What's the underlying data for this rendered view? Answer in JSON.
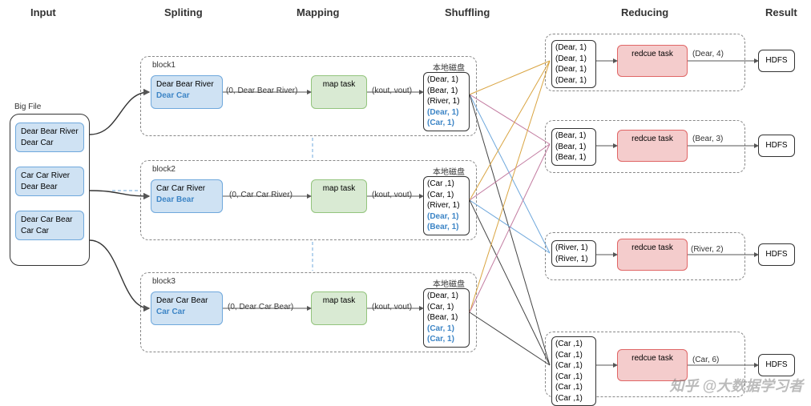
{
  "stages": {
    "input": "Input",
    "splitting": "Spliting",
    "mapping": "Mapping",
    "shuffling": "Shuffling",
    "reducing": "Reducing",
    "result": "Result"
  },
  "input": {
    "title": "Big File",
    "lines": [
      "Dear Bear River\nDear Car",
      "Car Car River\nDear Bear",
      "Dear Car Bear\nCar Car"
    ]
  },
  "blocks": [
    {
      "name": "block1",
      "split_text": "Dear Bear River",
      "split_extra": "Dear Car",
      "map_input": "(0, Dear Bear River)",
      "map_task": "map task",
      "map_output_label": "(kout, vout)",
      "disk_label": "本地磁盘",
      "disk_lines": [
        "(Dear, 1)",
        "(Bear, 1)",
        "(River, 1)"
      ],
      "disk_extra": [
        "(Dear, 1)",
        "(Car, 1)"
      ]
    },
    {
      "name": "block2",
      "split_text": "Car Car River",
      "split_extra": "Dear Bear",
      "map_input": "(0, Car Car River)",
      "map_task": "map task",
      "map_output_label": "(kout, vout)",
      "disk_label": "本地磁盘",
      "disk_lines": [
        "(Car ,1)",
        "(Car, 1)",
        "(River, 1)"
      ],
      "disk_extra": [
        "(Dear, 1)",
        "(Bear, 1)"
      ]
    },
    {
      "name": "block3",
      "split_text": "Dear Car Bear",
      "split_extra": "Car Car",
      "map_input": "(0, Dear Car Bear)",
      "map_task": "map task",
      "map_output_label": "(kout, vout)",
      "disk_label": "本地磁盘",
      "disk_lines": [
        "(Dear, 1)",
        "(Car, 1)",
        "(Bear, 1)"
      ],
      "disk_extra": [
        "(Car, 1)",
        "(Car, 1)"
      ]
    }
  ],
  "reducers": [
    {
      "group_lines": [
        "(Dear, 1)",
        "(Dear, 1)",
        "(Dear, 1)",
        "(Dear, 1)"
      ],
      "task": "redcue task",
      "result": "(Dear, 4)",
      "sink": "HDFS"
    },
    {
      "group_lines": [
        "(Bear, 1)",
        "(Bear, 1)",
        "(Bear, 1)"
      ],
      "task": "redcue task",
      "result": "(Bear, 3)",
      "sink": "HDFS"
    },
    {
      "group_lines": [
        "(River, 1)",
        "(River, 1)"
      ],
      "task": "redcue task",
      "result": "(River, 2)",
      "sink": "HDFS"
    },
    {
      "group_lines": [
        "(Car ,1)",
        "(Car ,1)",
        "(Car ,1)",
        "(Car ,1)",
        "(Car ,1)",
        "(Car ,1)"
      ],
      "task": "redcue task",
      "result": "(Car, 6)",
      "sink": "HDFS"
    }
  ],
  "watermark": "知乎 @大数据学习者"
}
